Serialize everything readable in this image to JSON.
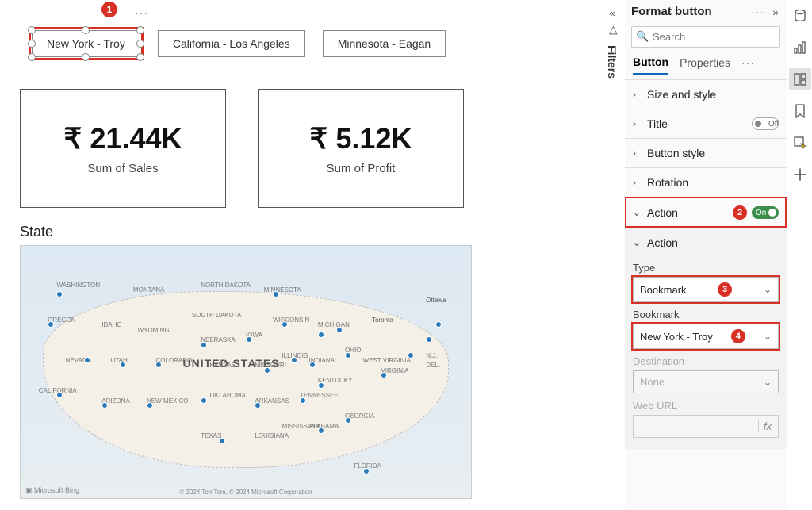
{
  "buttons": {
    "b1": "New York - Troy",
    "b2": "California - Los Angeles",
    "b3": "Minnesota - Eagan"
  },
  "cards": {
    "sales_value": "₹ 21.44K",
    "sales_label": "Sum of Sales",
    "profit_value": "₹ 5.12K",
    "profit_label": "Sum of Profit"
  },
  "map": {
    "title": "State",
    "center_label": "UNITED STATES",
    "bing": "Microsoft Bing",
    "attrib": "© 2024 TomTom, © 2024 Microsoft Corporation",
    "states": [
      "WASHINGTON",
      "MONTANA",
      "NORTH DAKOTA",
      "MINNESOTA",
      "OREGON",
      "IDAHO",
      "SOUTH DAKOTA",
      "WYOMING",
      "WISCONSIN",
      "MICHIGAN",
      "IOWA",
      "NEBRASKA",
      "NEVADA",
      "UTAH",
      "COLORADO",
      "KANSAS",
      "MISSOURI",
      "ILLINOIS",
      "INDIANA",
      "OHIO",
      "KENTUCKY",
      "TENNESSEE",
      "CALIFORNIA",
      "ARIZONA",
      "NEW MEXICO",
      "OKLAHOMA",
      "ARKANSAS",
      "TEXAS",
      "LOUISIANA",
      "MISSISSIPPI",
      "ALABAMA",
      "GEORGIA",
      "FLORIDA",
      "VIRGINIA",
      "WEST VIRGINIA",
      "N.J.",
      "DEL."
    ],
    "cities": [
      "Ottawa",
      "Toronto"
    ]
  },
  "filters_label": "Filters",
  "panel": {
    "title": "Format button",
    "search_placeholder": "Search",
    "tabs": {
      "button": "Button",
      "properties": "Properties"
    },
    "sections": {
      "size": "Size and style",
      "title": "Title",
      "title_toggle": "Off",
      "style": "Button style",
      "rotation": "Rotation",
      "action": "Action",
      "action_toggle": "On"
    },
    "action_group": {
      "header": "Action",
      "type_label": "Type",
      "type_value": "Bookmark",
      "bookmark_label": "Bookmark",
      "bookmark_value": "New York - Troy",
      "destination_label": "Destination",
      "destination_value": "None",
      "weburl_label": "Web URL"
    }
  },
  "markers": {
    "m1": "1",
    "m2": "2",
    "m3": "3",
    "m4": "4"
  },
  "fx": "fx"
}
